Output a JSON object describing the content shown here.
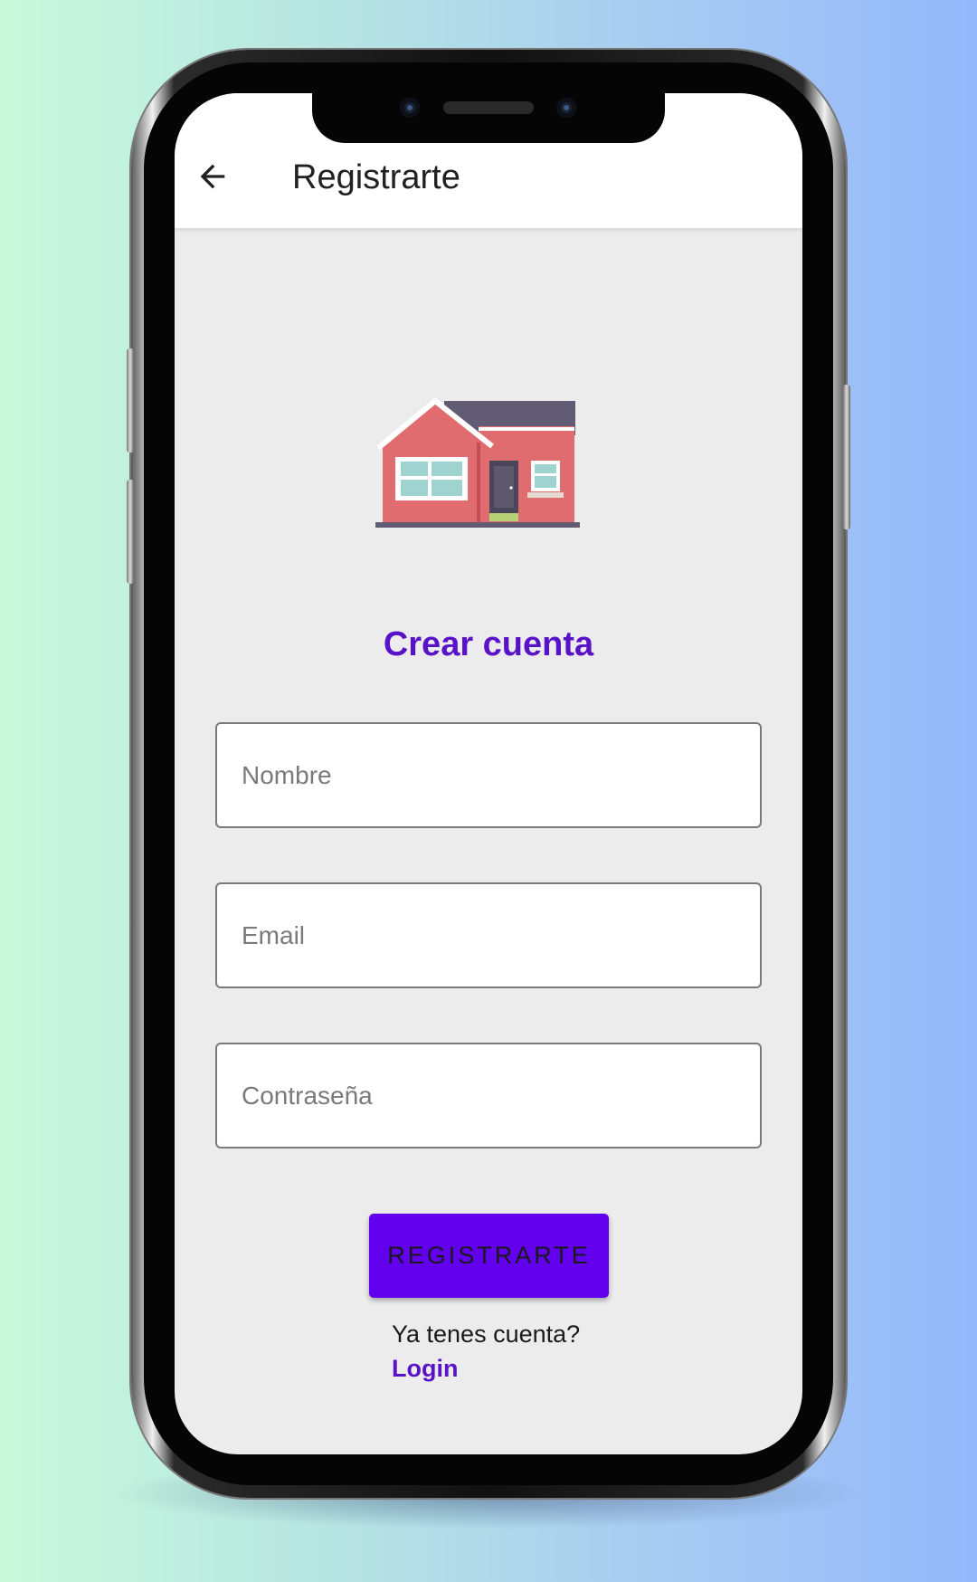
{
  "app_bar": {
    "title": "Registrarte",
    "back_icon": "arrow-left-icon"
  },
  "hero": {
    "image": "house-illustration"
  },
  "form": {
    "heading": "Crear cuenta",
    "name_placeholder": "Nombre",
    "email_placeholder": "Email",
    "password_placeholder": "Contraseña",
    "submit_label": "REGISTRARTE"
  },
  "footer": {
    "question": "Ya tenes cuenta?",
    "login_link": "Login"
  },
  "colors": {
    "accent": "#6200ee",
    "heading": "#5a12c8",
    "screen_background": "#ececed"
  }
}
